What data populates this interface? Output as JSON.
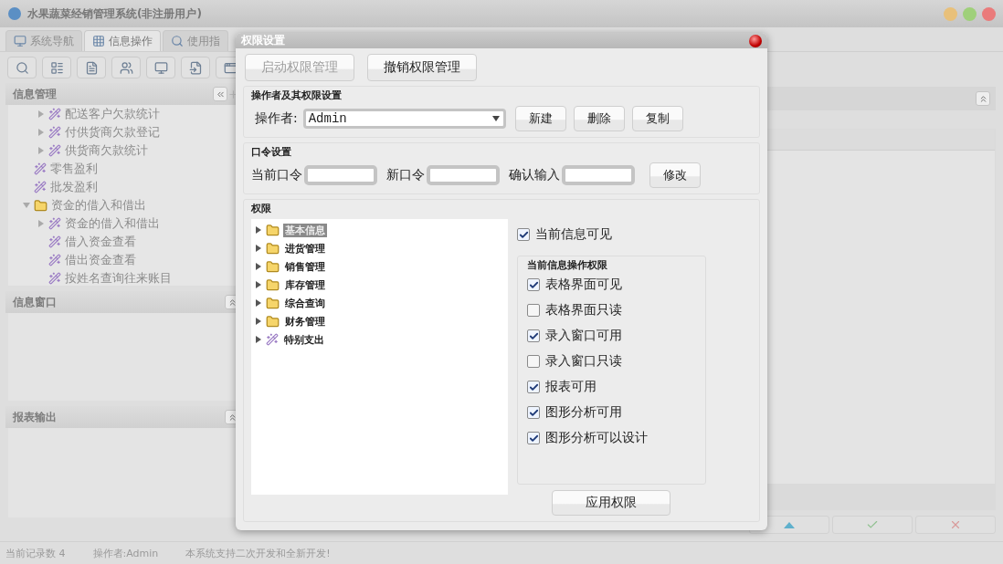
{
  "window": {
    "title": "水果蔬菜经销管理系统(非注册用户)"
  },
  "tabs": [
    {
      "label": "系统导航",
      "selected": false
    },
    {
      "label": "信息操作",
      "selected": true
    },
    {
      "label": "使用指",
      "selected": false
    }
  ],
  "info_management": {
    "title": "信息管理",
    "tree": [
      {
        "children": [
          {
            "label": "配送客户欠款统计",
            "kind": "leaf",
            "expanded": false
          },
          {
            "label": "付供货商欠款登记",
            "kind": "leaf",
            "expanded": false
          },
          {
            "label": "供货商欠款统计",
            "kind": "leaf",
            "expanded": false
          }
        ]
      },
      {
        "label": "零售盈利",
        "kind": "leaf"
      },
      {
        "label": "批发盈利",
        "kind": "leaf"
      },
      {
        "label": "资金的借入和借出",
        "kind": "folder",
        "expanded": true,
        "children": [
          {
            "label": "资金的借入和借出",
            "kind": "leaf",
            "expanded": false
          },
          {
            "label": "借入资金查看",
            "kind": "leaf"
          },
          {
            "label": "借出资金查看",
            "kind": "leaf"
          },
          {
            "label": "按姓名查询往来账目",
            "kind": "leaf"
          }
        ]
      }
    ]
  },
  "info_window": {
    "title": "信息窗口"
  },
  "report_output": {
    "title": "报表输出"
  },
  "status_bar": [
    "当前记录数 4",
    "操作者:Admin",
    "本系统支持二次开发和全新开发!"
  ],
  "dialog": {
    "title": "权限设置",
    "top_buttons": [
      {
        "label": "启动权限管理",
        "disabled": true
      },
      {
        "label": "撤销权限管理",
        "disabled": false
      }
    ],
    "operator_group": {
      "title": "操作者及其权限设置",
      "label": "操作者:",
      "value": "Admin",
      "buttons": [
        "新建",
        "删除",
        "复制"
      ]
    },
    "password_group": {
      "title": "口令设置",
      "fields": [
        {
          "label": "当前口令"
        },
        {
          "label": "新口令"
        },
        {
          "label": "确认输入"
        }
      ],
      "button": "修改"
    },
    "permissions": {
      "title": "权限",
      "tree": [
        {
          "label": "基本信息",
          "kind": "folder",
          "selected": true
        },
        {
          "label": "进货管理",
          "kind": "folder",
          "selected": false
        },
        {
          "label": "销售管理",
          "kind": "folder",
          "selected": false
        },
        {
          "label": "库存管理",
          "kind": "folder",
          "selected": false
        },
        {
          "label": "综合查询",
          "kind": "folder",
          "selected": false
        },
        {
          "label": "财务管理",
          "kind": "folder",
          "selected": false
        },
        {
          "label": "特别支出",
          "kind": "leaf",
          "selected": false
        }
      ],
      "visible": {
        "label": "当前信息可见",
        "checked": true
      },
      "operations": {
        "title": "当前信息操作权限",
        "options": [
          {
            "label": "表格界面可见",
            "checked": true
          },
          {
            "label": "表格界面只读",
            "checked": false
          },
          {
            "label": "录入窗口可用",
            "checked": true
          },
          {
            "label": "录入窗口只读",
            "checked": false
          },
          {
            "label": "报表可用",
            "checked": true
          },
          {
            "label": "图形分析可用",
            "checked": true
          },
          {
            "label": "图形分析可以设计",
            "checked": true
          }
        ]
      },
      "apply_button": "应用权限"
    }
  }
}
